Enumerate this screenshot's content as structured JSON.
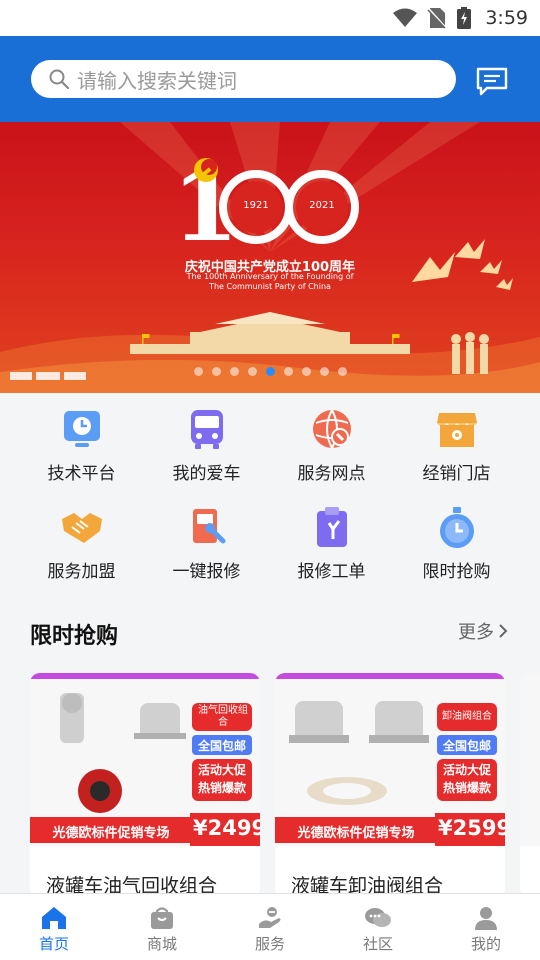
{
  "status_bar": {
    "time": "3:59"
  },
  "search": {
    "placeholder": "请输入搜索关键词"
  },
  "banner": {
    "headline": "庆祝中国共产党成立100周年",
    "subline_1": "The 100th Anniversary of the Founding of",
    "subline_2": "The Communist Party of China",
    "year_left": "1921",
    "year_right": "2021",
    "big_number": "100",
    "dot_count": 9,
    "active_dot": 4
  },
  "shortcuts": [
    {
      "label": "技术平台",
      "icon": "clock-screen-icon"
    },
    {
      "label": "我的爱车",
      "icon": "bus-icon"
    },
    {
      "label": "服务网点",
      "icon": "globe-wrench-icon"
    },
    {
      "label": "经销门店",
      "icon": "store-icon"
    },
    {
      "label": "服务加盟",
      "icon": "handshake-icon"
    },
    {
      "label": "一键报修",
      "icon": "repair-wrench-icon"
    },
    {
      "label": "报修工单",
      "icon": "clipboard-icon"
    },
    {
      "label": "限时抢购",
      "icon": "timer-icon"
    }
  ],
  "flash_sale": {
    "title": "限时抢购",
    "more_label": "更多",
    "products": [
      {
        "name": "液罐车油气回收组合",
        "promo_banner": "光德欧标件促销专场",
        "price": "¥2499",
        "tag_top": "油气回收组合",
        "tag_mid": "全国包邮",
        "tag_bottom": "活动大促 热销爆款"
      },
      {
        "name": "液罐车卸油阀组合",
        "promo_banner": "光德欧标件促销专场",
        "price": "¥2599",
        "tag_top": "卸油阀组合",
        "tag_mid": "全国包邮",
        "tag_bottom": "活动大促 热销爆款"
      }
    ]
  },
  "tabbar": {
    "items": [
      {
        "label": "首页",
        "icon": "home-icon",
        "active": true
      },
      {
        "label": "商城",
        "icon": "shopping-bag-icon",
        "active": false
      },
      {
        "label": "服务",
        "icon": "service-hand-icon",
        "active": false
      },
      {
        "label": "社区",
        "icon": "chat-bubbles-icon",
        "active": false
      },
      {
        "label": "我的",
        "icon": "user-icon",
        "active": false
      }
    ]
  },
  "colors": {
    "header_blue": "#1a6fd6",
    "active_tab": "#1a73e8",
    "banner_red": "#d8241e",
    "promo_red": "#e52b2b"
  }
}
